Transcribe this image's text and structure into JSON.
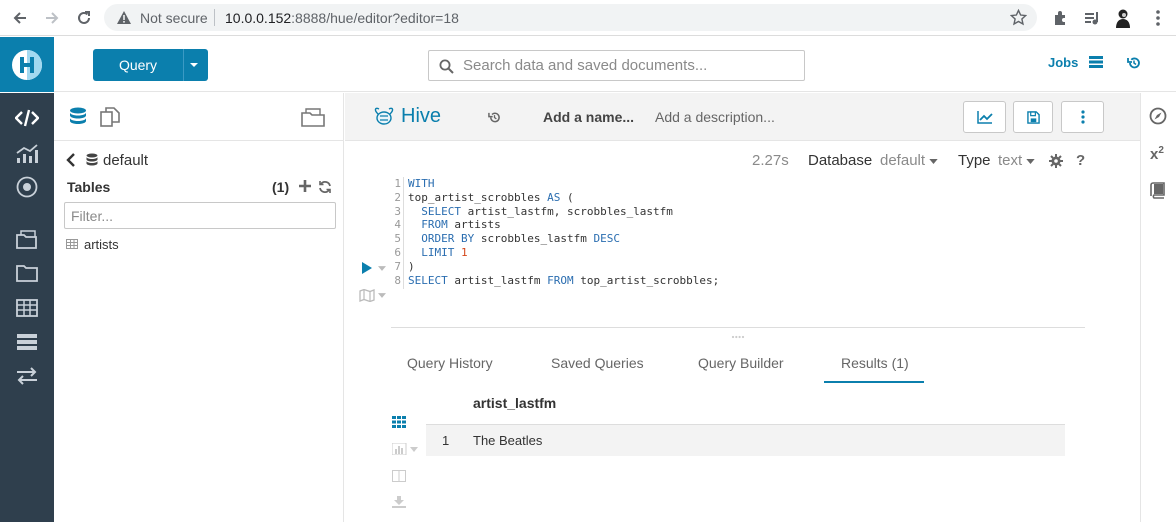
{
  "browser": {
    "security": "Not secure",
    "url_host": "10.0.0.152",
    "url_rest": ":8888/hue/editor?editor=18"
  },
  "header": {
    "query_button": "Query",
    "search_placeholder": "Search data and saved documents...",
    "jobs_label": "Jobs"
  },
  "assist": {
    "database": "default",
    "tables_title": "Tables",
    "tables_count": "(1)",
    "filter_placeholder": "Filter...",
    "tables": [
      "artists"
    ]
  },
  "editor": {
    "language": "Hive",
    "name_placeholder": "Add a name...",
    "description_placeholder": "Add a description...",
    "exec_time": "2.27s",
    "database_label": "Database",
    "database_value": "default",
    "type_label": "Type",
    "type_value": "text",
    "help": "?",
    "line_numbers": [
      "1",
      "2",
      "3",
      "4",
      "5",
      "6",
      "7",
      "8"
    ]
  },
  "results": {
    "tabs": [
      "Query History",
      "Saved Queries",
      "Query Builder",
      "Results (1)"
    ],
    "active_tab": 3,
    "column": "artist_lastfm",
    "rows": [
      {
        "num": "1",
        "value": "The Beatles"
      }
    ]
  },
  "right_panel": {
    "functions_label": "x",
    "functions_sup": "2"
  },
  "colors": {
    "accent": "#0b7fad",
    "nav": "#2f3f4d"
  }
}
